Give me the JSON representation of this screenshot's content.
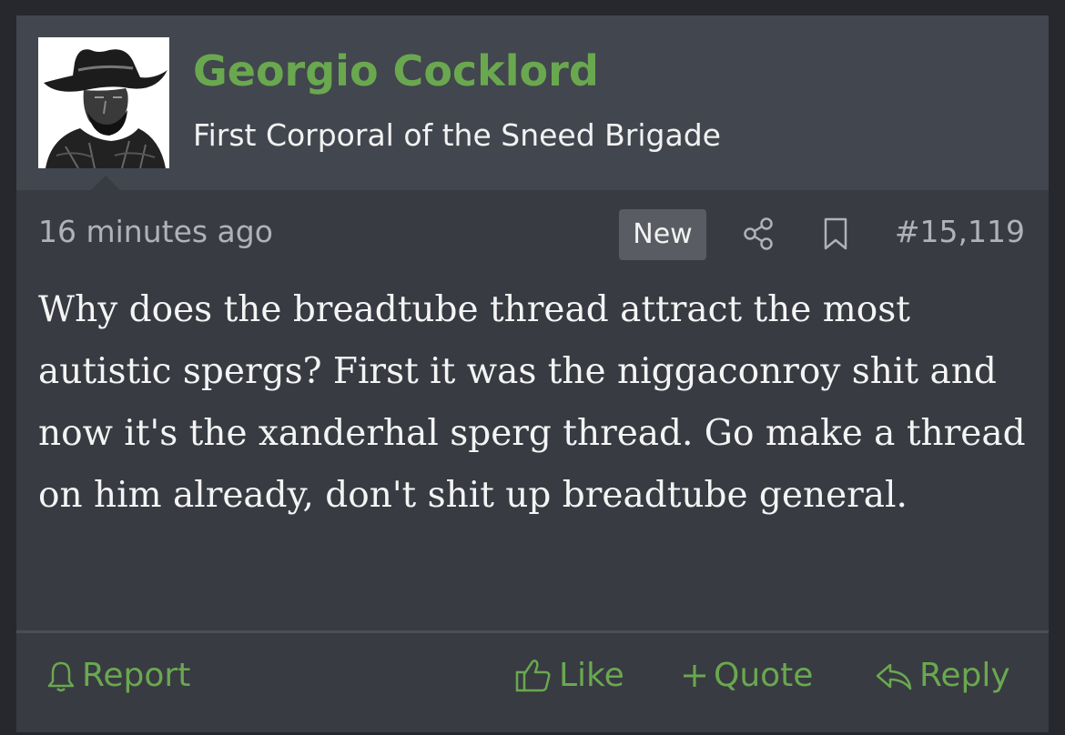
{
  "user": {
    "name": "Georgio Cocklord",
    "title": "First Corporal of the Sneed Brigade",
    "avatar_icon": "cowboy-avatar"
  },
  "meta": {
    "timestamp": "16 minutes ago",
    "badge": "New",
    "share_icon": "share-icon",
    "bookmark_icon": "bookmark-icon",
    "post_number": "#15,119"
  },
  "message": {
    "text": "Why does the breadtube thread attract the most autistic spergs? First it was the niggaconroy shit and now it's the xanderhal sperg thread. Go make a thread on him already, don't shit up breadtube general."
  },
  "actions": {
    "report": "Report",
    "like": "Like",
    "quote": "Quote",
    "reply": "Reply"
  },
  "colors": {
    "accent": "#6aa84f",
    "header_bg": "#42464e",
    "body_bg": "#383b42",
    "badge_bg": "#595c62"
  }
}
